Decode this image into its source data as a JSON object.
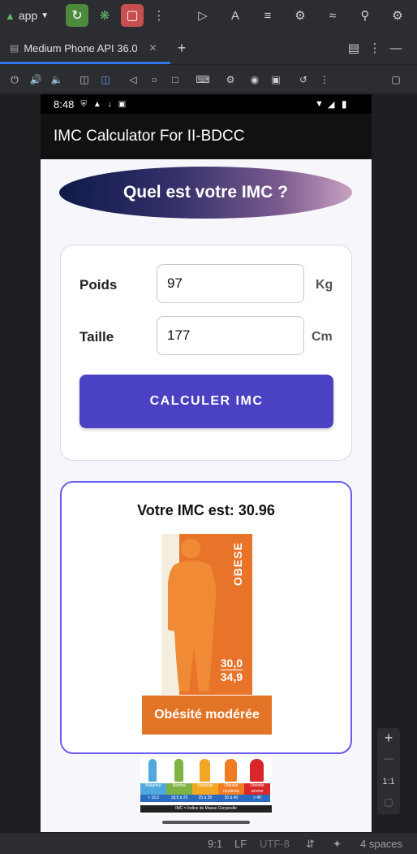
{
  "ide": {
    "app_label": "app",
    "tab_label": "Medium Phone API 36.0",
    "status": {
      "position": "9:1",
      "line_sep": "LF",
      "encoding": "UTF-8",
      "indent": "4 spaces"
    },
    "zoom": {
      "plus": "+",
      "minus": "—",
      "ratio": "1:1"
    }
  },
  "phone": {
    "time": "8:48",
    "app_title": "IMC Calculator For II-BDCC",
    "heading": "Quel est votre IMC ?",
    "form": {
      "weight_label": "Poids",
      "weight_value": "97",
      "weight_unit": "Kg",
      "height_label": "Taille",
      "height_value": "177",
      "height_unit": "Cm",
      "button": "CALCULER IMC"
    },
    "result": {
      "text": "Votre IMC est: 30.96",
      "figure_label": "OBESE",
      "figure_range_top": "30,0",
      "figure_range_bottom": "34,9",
      "category": "Obésité modérée"
    },
    "scale": {
      "columns": [
        {
          "label": "Maigreur",
          "range": "< 18,5",
          "color": "#4fa9dc"
        },
        {
          "label": "Normal",
          "range": "18,5 à 25",
          "color": "#7cb342"
        },
        {
          "label": "Surpoids",
          "range": "25 à 30",
          "color": "#f2a623"
        },
        {
          "label": "Obésité modérée",
          "range": "30 à 40",
          "color": "#ef7b22"
        },
        {
          "label": "Obésité sévère",
          "range": "> 40",
          "color": "#d9262a"
        }
      ],
      "footer": "IMC = Indice de Masse Corporelle"
    }
  },
  "colors": {
    "accent": "#4a42c2",
    "result_border": "#6a5cf0",
    "category_bg": "#e27426",
    "ide_bg": "#2b2d30"
  }
}
